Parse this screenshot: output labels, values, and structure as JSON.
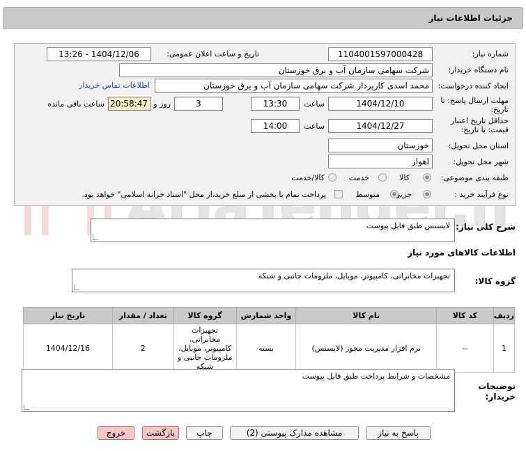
{
  "header": {
    "title": "جزئیات اطلاعات نیاز"
  },
  "form": {
    "need_number_label": "شماره نیاز:",
    "need_number": "1104001597000428",
    "announce_label": "تاریخ و ساعت اعلان عمومی:",
    "announce_value": "1404/12/06 - 13:26",
    "buyer_label": "نام دستگاه خریدار:",
    "buyer_value": "شرکت سهامی سازمان آب و برق خوزستان",
    "creator_label": "ایجاد کننده درخواست:",
    "creator_value": "محمد اسدی کارپرداز شرکت سهامی سازمان آب و برق خوزستان",
    "contact_link": "اطلاعات تماس خریدار",
    "deadline_label_1": "مهلت ارسال پاسخ: تا",
    "deadline_label_2": "تاریخ:",
    "deadline_date": "1404/12/10",
    "time_label": "ساعت",
    "deadline_time": "13:30",
    "days_value": "3",
    "days_label": "روز و",
    "remaining_time": "20:58:47",
    "remaining_label": "ساعت باقی مانده",
    "validity_label_1": "حداقل تاریخ اعتبار",
    "validity_label_2": "قیمت: تا تاریخ:",
    "validity_date": "1404/12/27",
    "validity_time": "14:00",
    "province_label": "استان محل تحویل:",
    "province_value": "خوزستان",
    "city_label": "شهر محل تحویل:",
    "city_value": "اهواز",
    "category_label": "طبقه بندی موضوعی:",
    "category_options": [
      "کالا",
      "خدمت",
      "کالا/خدمت"
    ],
    "process_label": "نوع فرآیند خرید :",
    "process_options": [
      "جزیی",
      "متوسط"
    ],
    "payment_note": "پرداخت تمام یا بخشی از مبلغ خرید،از محل \"اسناد خزانه اسلامی\" خواهد بود."
  },
  "summary": {
    "label": "شرح کلی نیاز:",
    "value": "لایسنس طبق فایل پیوست"
  },
  "goods": {
    "section_title": "اطلاعات کالاهای مورد نیاز",
    "group_label": "گروه کالا:",
    "group_value": "تجهیزات مخابراتی، کامپیوتر، موبایل، ملزومات جانبی و شبکه"
  },
  "table": {
    "headers": [
      "ردیف",
      "کد کالا",
      "نام کالا",
      "واحد شمارش",
      "گروه کالا",
      "تعداد / مقدار",
      "تاریخ نیاز"
    ],
    "rows": [
      [
        "1",
        "--",
        "نرم افزار مدیریت مجوز (لایسنس)",
        "بسته",
        "تجهیزات مخابراتی، کامپیوتر، موبایل، ملزومات جانبی و شبکه",
        "2",
        "1404/12/16"
      ]
    ]
  },
  "buyer_notes": {
    "label_1": "توضیحات",
    "label_2": "خریدار:",
    "value": "مشخصات و شرایط پرداخت طبق فایل پیوست"
  },
  "buttons": {
    "reply": "پاسخ به نیاز",
    "attachments": "مشاهده مدارک پیوستی (2)",
    "print": "چاپ",
    "back": "بازگشت",
    "exit": "خروج"
  },
  "watermark": {
    "text": "AriaTender.neT"
  }
}
